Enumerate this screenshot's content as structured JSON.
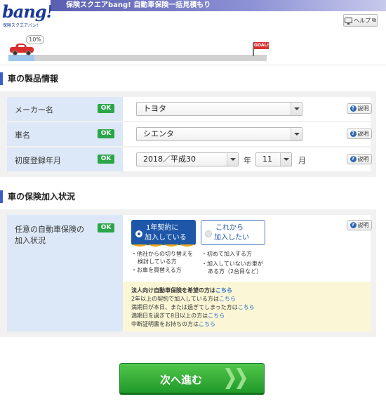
{
  "header": {
    "logo_text": "bang!",
    "logo_sub": "保険スクエアバン!",
    "bar_text": "保険スクエアbang! 自動車保険一括見積もり",
    "help_label": "ヘルプ",
    "help_icon": "monitor-icon",
    "external_icon": "external-link-icon"
  },
  "progress": {
    "percent_label": "10%",
    "fraction": 0.1,
    "goal_label": "GOAL!"
  },
  "product_section": {
    "title": "車の製品情報",
    "rows": [
      {
        "label": "メーカー名",
        "status": "OK",
        "value": "トヨタ",
        "help": "説明"
      },
      {
        "label": "車名",
        "status": "OK",
        "value": "シエンタ",
        "help": "説明"
      },
      {
        "label": "初度登録年月",
        "status": "OK",
        "year_value": "2018／平成30",
        "year_unit": "年",
        "month_value": "11",
        "month_unit": "月",
        "help": "説明"
      }
    ]
  },
  "insurance_section": {
    "title": "車の保険加入状況",
    "label_line1": "任意の自動車保険の",
    "label_line2": "加入状況",
    "status": "OK",
    "help": "説明",
    "options": [
      {
        "line1": "1年契約に",
        "line2": "加入している",
        "selected": true
      },
      {
        "line1": "これから",
        "line2": "加入したい",
        "selected": false
      }
    ],
    "notes_left": [
      "他社からの切り替えを",
      "検討している方",
      "お車を買替える方"
    ],
    "notes_right": [
      "初めて加入する方",
      "加入していないお車が",
      "ある方（2台目など）"
    ],
    "info": {
      "corporate_text": "法人向け自動車保険を希望の方は",
      "corporate_link": "こちら",
      "lines": [
        {
          "text": "2年以上の契約で加入している方は",
          "link": "こちら"
        },
        {
          "text": "満期日が本日、または過ぎてしまった方は",
          "link": "こちら"
        },
        {
          "text": "満期日を過ぎて8日以上の方は",
          "link": "こちら"
        },
        {
          "text": "中断証明書をお持ちの方は",
          "link": "こちら"
        }
      ]
    }
  },
  "next_button": {
    "label": "次へ進む"
  },
  "colors": {
    "accent_blue": "#1e57a8",
    "ok_green": "#2aa648",
    "next_green": "#1f9a2a",
    "label_bg": "#dce8f7",
    "link_blue": "#2367c7"
  }
}
